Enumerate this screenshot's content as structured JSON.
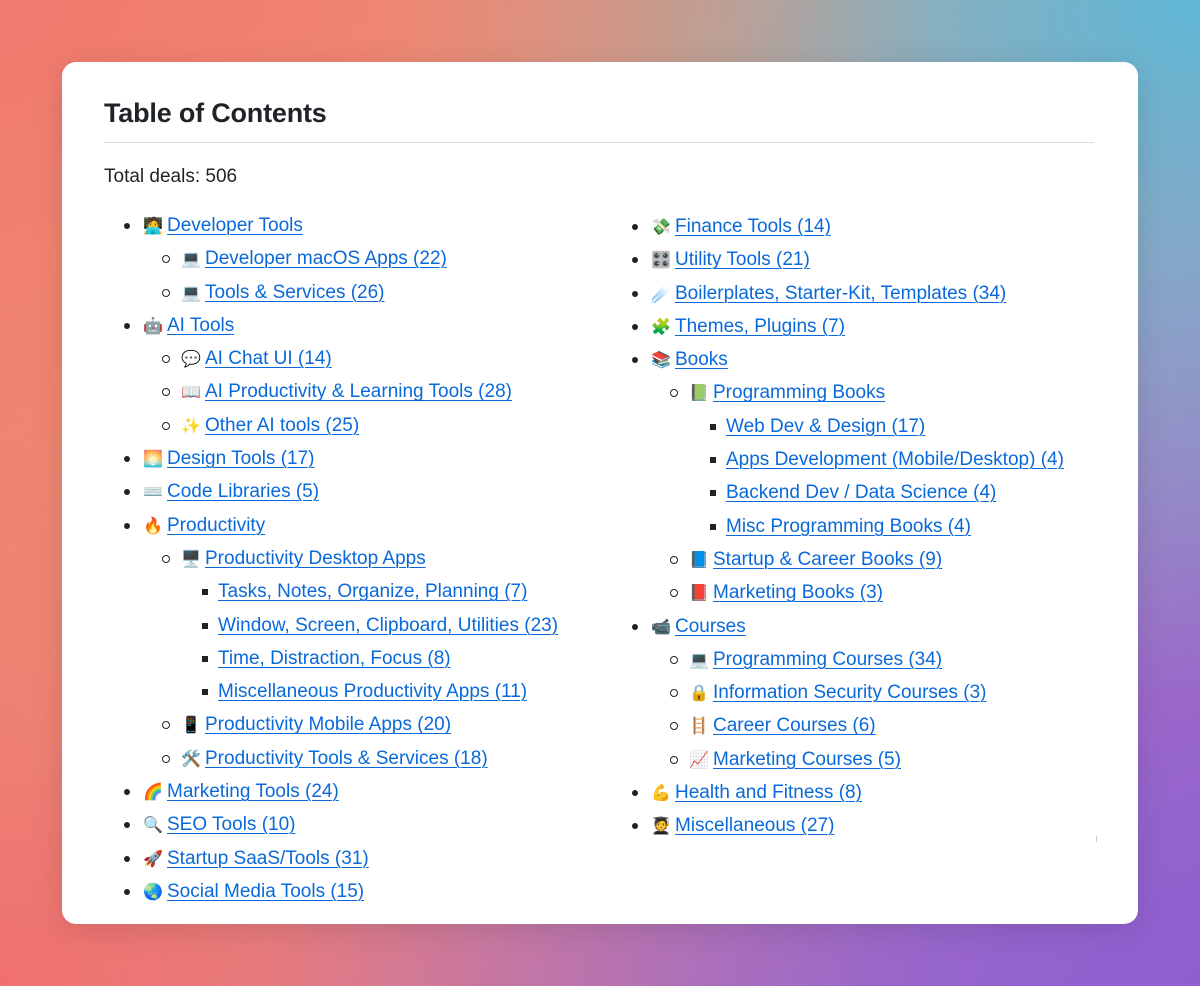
{
  "page": {
    "title": "Table of Contents",
    "total_deals": "Total deals: 506"
  },
  "colors": {
    "link": "#0969da",
    "text": "#1f2328",
    "divider": "#d8dee4"
  },
  "left_items": [
    {
      "level": 1,
      "emoji": "🧑‍💻",
      "label": "Developer Tools"
    },
    {
      "level": 2,
      "emoji": "💻",
      "label": "Developer macOS Apps (22)"
    },
    {
      "level": 2,
      "emoji": "💻",
      "label": "Tools & Services (26)"
    },
    {
      "level": 1,
      "emoji": "🤖",
      "label": "AI Tools"
    },
    {
      "level": 2,
      "emoji": "💬",
      "label": "AI Chat UI (14)"
    },
    {
      "level": 2,
      "emoji": "📖",
      "label": "AI Productivity & Learning Tools (28)"
    },
    {
      "level": 2,
      "emoji": "✨",
      "label": "Other AI tools (25)"
    },
    {
      "level": 1,
      "emoji": "🌅",
      "label": "Design Tools (17)"
    },
    {
      "level": 1,
      "emoji": "⌨️",
      "label": "Code Libraries (5)"
    },
    {
      "level": 1,
      "emoji": "🔥",
      "label": "Productivity"
    },
    {
      "level": 2,
      "emoji": "🖥️",
      "label": "Productivity Desktop Apps"
    },
    {
      "level": 3,
      "emoji": "",
      "label": "Tasks, Notes, Organize, Planning (7)"
    },
    {
      "level": 3,
      "emoji": "",
      "label": "Window, Screen, Clipboard, Utilities (23)"
    },
    {
      "level": 3,
      "emoji": "",
      "label": "Time, Distraction, Focus (8)"
    },
    {
      "level": 3,
      "emoji": "",
      "label": "Miscellaneous Productivity Apps (11)"
    },
    {
      "level": 2,
      "emoji": "📱",
      "label": "Productivity Mobile Apps (20)"
    },
    {
      "level": 2,
      "emoji": "🛠️",
      "label": "Productivity Tools & Services (18)"
    },
    {
      "level": 1,
      "emoji": "🌈",
      "label": "Marketing Tools (24)"
    },
    {
      "level": 1,
      "emoji": "🔍",
      "label": "SEO Tools (10)"
    },
    {
      "level": 1,
      "emoji": "🚀",
      "label": "Startup SaaS/Tools (31)"
    },
    {
      "level": 1,
      "emoji": "🌏",
      "label": "Social Media Tools (15)"
    }
  ],
  "right_items": [
    {
      "level": 1,
      "emoji": "💸",
      "label": "Finance Tools (14)"
    },
    {
      "level": 1,
      "emoji": "🎛️",
      "label": "Utility Tools (21)"
    },
    {
      "level": 1,
      "emoji": "☄️",
      "label": "Boilerplates, Starter-Kit, Templates (34)"
    },
    {
      "level": 1,
      "emoji": "🧩",
      "label": "Themes, Plugins (7)"
    },
    {
      "level": 1,
      "emoji": "📚",
      "label": "Books"
    },
    {
      "level": 2,
      "emoji": "📗",
      "label": "Programming Books"
    },
    {
      "level": 3,
      "emoji": "",
      "label": "Web Dev & Design (17)"
    },
    {
      "level": 3,
      "emoji": "",
      "label": "Apps Development (Mobile/Desktop) (4)"
    },
    {
      "level": 3,
      "emoji": "",
      "label": "Backend Dev / Data Science (4)"
    },
    {
      "level": 3,
      "emoji": "",
      "label": "Misc Programming Books (4)"
    },
    {
      "level": 2,
      "emoji": "📘",
      "label": "Startup & Career Books (9)"
    },
    {
      "level": 2,
      "emoji": "📕",
      "label": "Marketing Books (3)"
    },
    {
      "level": 1,
      "emoji": "📹",
      "label": "Courses"
    },
    {
      "level": 2,
      "emoji": "💻",
      "label": "Programming Courses (34)"
    },
    {
      "level": 2,
      "emoji": "🔒",
      "label": "Information Security Courses (3)"
    },
    {
      "level": 2,
      "emoji": "🪜",
      "label": "Career Courses (6)"
    },
    {
      "level": 2,
      "emoji": "📈",
      "label": "Marketing Courses (5)"
    },
    {
      "level": 1,
      "emoji": "💪",
      "label": "Health and Fitness (8)"
    },
    {
      "level": 1,
      "emoji": "🧑‍🎓",
      "label": "Miscellaneous (27)"
    }
  ]
}
